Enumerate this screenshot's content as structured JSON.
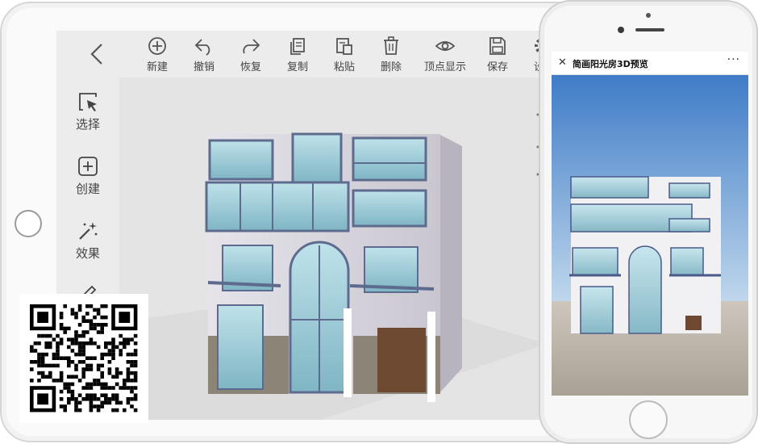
{
  "toolbar": {
    "items": [
      {
        "label": "新建",
        "icon": "plus-circle-icon"
      },
      {
        "label": "撤销",
        "icon": "undo-icon"
      },
      {
        "label": "恢复",
        "icon": "redo-icon"
      },
      {
        "label": "复制",
        "icon": "copy-icon"
      },
      {
        "label": "粘贴",
        "icon": "paste-icon"
      },
      {
        "label": "删除",
        "icon": "trash-icon"
      },
      {
        "label": "顶点显示",
        "icon": "eye-icon"
      },
      {
        "label": "保存",
        "icon": "save-icon"
      },
      {
        "label": "设",
        "icon": "gear-icon"
      }
    ]
  },
  "sidebar": {
    "items": [
      {
        "label": "选择",
        "icon": "select-cursor-icon"
      },
      {
        "label": "创建",
        "icon": "plus-square-icon"
      },
      {
        "label": "效果",
        "icon": "magic-wand-icon"
      },
      {
        "label": "",
        "icon": "pencil-icon"
      }
    ]
  },
  "phone": {
    "title": "简画阳光房3D预览",
    "close_glyph": "✕",
    "more_glyph": "···"
  },
  "colors": {
    "toolbar_bg": "#ececec",
    "viewport_bg": "#e4e4e4",
    "glass": "#a9d3de",
    "frame": "#5d6b8e",
    "sky_top": "#3f7cc7",
    "sky_bottom": "#c7dcee"
  }
}
